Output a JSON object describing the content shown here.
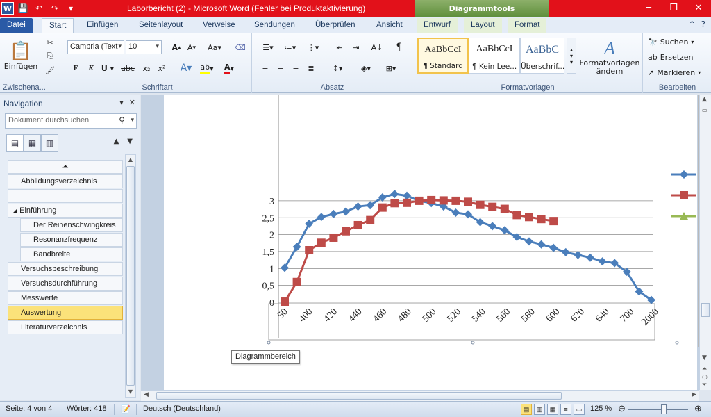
{
  "window": {
    "title": "Laborbericht (2)  -  Microsoft Word (Fehler bei Produktaktivierung)",
    "context_tab_group": "Diagrammtools"
  },
  "tabs": {
    "file": "Datei",
    "start": "Start",
    "einfuegen": "Einfügen",
    "seitenlayout": "Seitenlayout",
    "verweise": "Verweise",
    "sendungen": "Sendungen",
    "ueberpruefen": "Überprüfen",
    "ansicht": "Ansicht",
    "entwurf": "Entwurf",
    "layout": "Layout",
    "format": "Format"
  },
  "ribbon": {
    "clipboard": {
      "label": "Zwischena...",
      "paste": "Einfügen"
    },
    "font": {
      "label": "Schriftart",
      "family": "Cambria (Text",
      "size": "10"
    },
    "paragraph": {
      "label": "Absatz"
    },
    "styles": {
      "label": "Formatvorlagen",
      "items": [
        {
          "sample": "AaBbCcI",
          "name": "¶ Standard"
        },
        {
          "sample": "AaBbCcI",
          "name": "¶ Kein Lee..."
        },
        {
          "sample": "AaBbC",
          "name": "Überschrif..."
        }
      ],
      "change": "Formatvorlagen ändern"
    },
    "editing": {
      "label": "Bearbeiten",
      "find": "Suchen",
      "replace": "Ersetzen",
      "select": "Markieren"
    }
  },
  "nav": {
    "title": "Navigation",
    "search_placeholder": "Dokument durchsuchen",
    "items": [
      {
        "label": "",
        "kind": "collapse"
      },
      {
        "label": "Abbildungsverzeichnis"
      },
      {
        "label": ""
      },
      {
        "label": "Einführung"
      },
      {
        "label": "Der Reihenschwingkreis"
      },
      {
        "label": "Resonanzfrequenz"
      },
      {
        "label": "Bandbreite"
      },
      {
        "label": "Versuchsbeschreibung"
      },
      {
        "label": "Versuchsdurchführung"
      },
      {
        "label": "Messwerte"
      },
      {
        "label": "Auswertung"
      },
      {
        "label": "Literaturverzeichnis"
      }
    ]
  },
  "tooltip": "Diagrammbereich",
  "status": {
    "page": "Seite: 4 von 4",
    "words": "Wörter: 418",
    "language": "Deutsch (Deutschland)",
    "zoom": "125 %"
  },
  "colors": {
    "title_bar": "#e2111a",
    "series_blue": "#4a7ebb",
    "series_red": "#be4b48",
    "series_green": "#98b954"
  },
  "chart_data": {
    "type": "line",
    "categories": [
      "50",
      "400",
      "420",
      "440",
      "460",
      "480",
      "500",
      "520",
      "540",
      "560",
      "580",
      "600",
      "620",
      "640",
      "700",
      "2000"
    ],
    "y_ticks": [
      "0",
      "0,5",
      "1",
      "1,5",
      "2",
      "2,5",
      "3"
    ],
    "ylim": [
      0,
      3
    ],
    "grid": true,
    "legend": "right",
    "series": [
      {
        "color": "#4a7ebb",
        "marker": "diamond",
        "values": [
          1.02,
          1.64,
          2.32,
          2.52,
          2.61,
          2.68,
          2.83,
          2.87,
          3.1,
          3.2,
          3.15,
          3.0,
          2.93,
          2.83,
          2.65,
          2.6,
          2.37,
          2.25,
          2.13,
          1.93,
          1.8,
          1.71,
          1.61,
          1.48,
          1.4,
          1.32,
          1.21,
          1.16,
          0.9,
          0.32,
          0.07
        ]
      },
      {
        "color": "#be4b48",
        "marker": "square",
        "values": [
          0.02,
          0.6,
          1.54,
          1.76,
          1.91,
          2.1,
          2.28,
          2.43,
          2.8,
          2.93,
          2.94,
          3.0,
          3.02,
          3.01,
          3.0,
          2.97,
          2.88,
          2.82,
          2.76,
          2.58,
          2.52,
          2.46,
          2.4
        ]
      },
      {
        "color": "#98b954",
        "marker": "triangle",
        "values": []
      }
    ]
  }
}
